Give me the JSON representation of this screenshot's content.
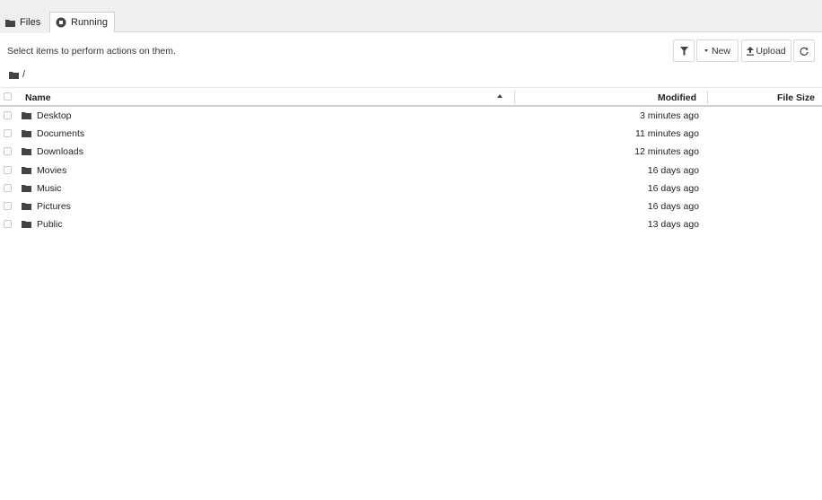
{
  "tabs": [
    {
      "label": "Files",
      "icon": "folder-icon"
    },
    {
      "label": "Running",
      "icon": "stop-circle-icon"
    }
  ],
  "toolbar": {
    "hint": "Select items to perform actions on them.",
    "filter_icon": "filter-icon",
    "new_label": "New",
    "upload_label": "Upload",
    "refresh_icon": "refresh-icon"
  },
  "breadcrumb": {
    "path": "/"
  },
  "table": {
    "columns": {
      "name": "Name",
      "modified": "Modified",
      "size": "File Size"
    },
    "sort": {
      "column": "Name",
      "direction": "ascending"
    },
    "rows": [
      {
        "name": "Desktop",
        "modified": "3 minutes ago"
      },
      {
        "name": "Documents",
        "modified": "11 minutes ago"
      },
      {
        "name": "Downloads",
        "modified": "12 minutes ago"
      },
      {
        "name": "Movies",
        "modified": "16 days ago"
      },
      {
        "name": "Music",
        "modified": "16 days ago"
      },
      {
        "name": "Pictures",
        "modified": "16 days ago"
      },
      {
        "name": "Public",
        "modified": "13 days ago"
      }
    ]
  }
}
